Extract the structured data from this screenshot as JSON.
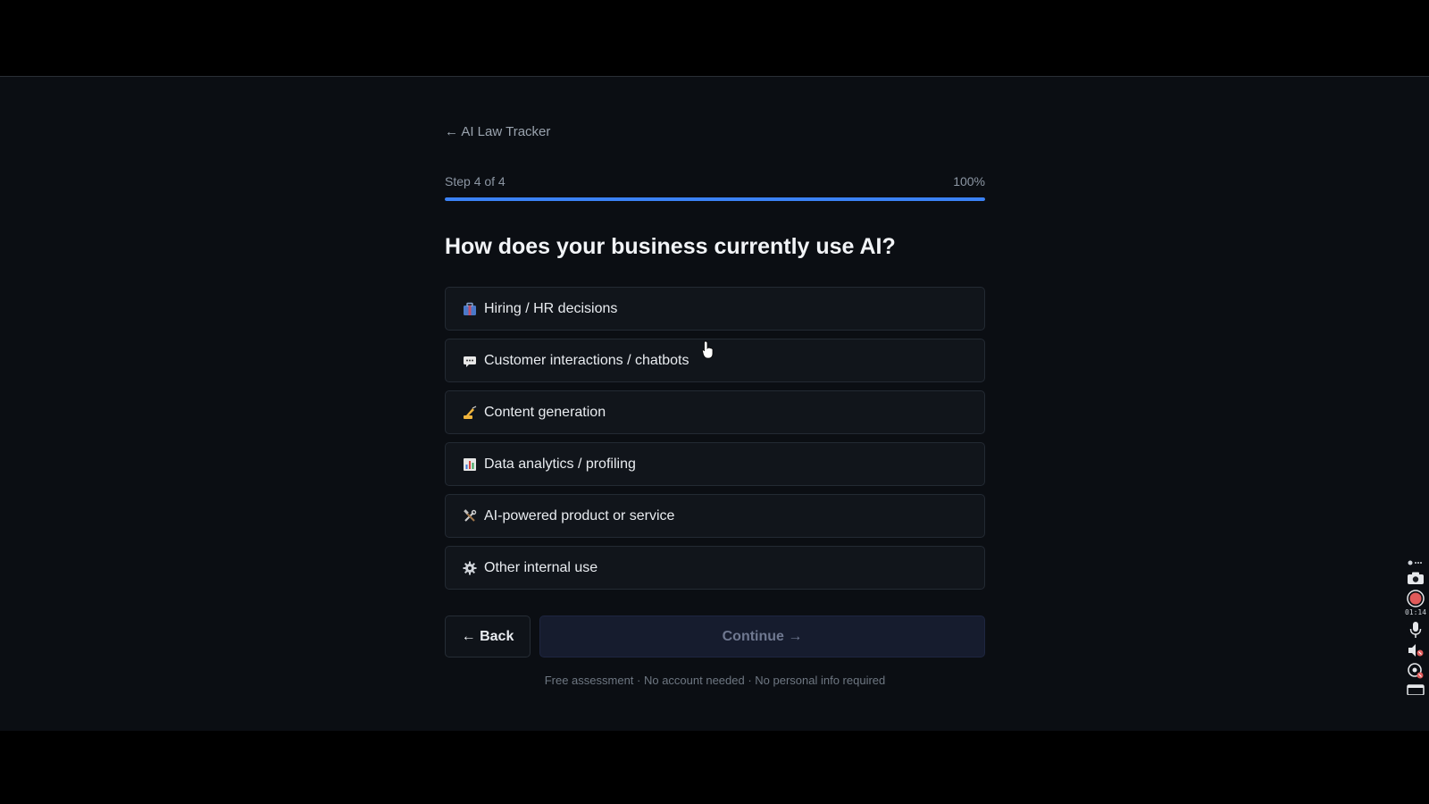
{
  "nav": {
    "back_link": "← AI Law Tracker"
  },
  "progress": {
    "step_label": "Step 4 of 4",
    "percent_label": "100%",
    "fraction": 1.0
  },
  "question": "How does your business currently use AI?",
  "options": [
    {
      "icon": "briefcase-icon",
      "label": "Hiring / HR decisions"
    },
    {
      "icon": "chat-bubble-icon",
      "label": "Customer interactions / chatbots"
    },
    {
      "icon": "writing-hand-icon",
      "label": "Content generation"
    },
    {
      "icon": "bar-chart-icon",
      "label": "Data analytics / profiling"
    },
    {
      "icon": "tools-icon",
      "label": "AI-powered product or service"
    },
    {
      "icon": "gear-icon",
      "label": "Other internal use"
    }
  ],
  "buttons": {
    "back": "← Back",
    "continue": "Continue →"
  },
  "footnote": "Free assessment · No account needed · No personal info required",
  "recorder": {
    "timer": "01:14"
  },
  "colors": {
    "accent": "#3b82f6",
    "background": "#0b0e13",
    "option_bg": "#11151b"
  }
}
